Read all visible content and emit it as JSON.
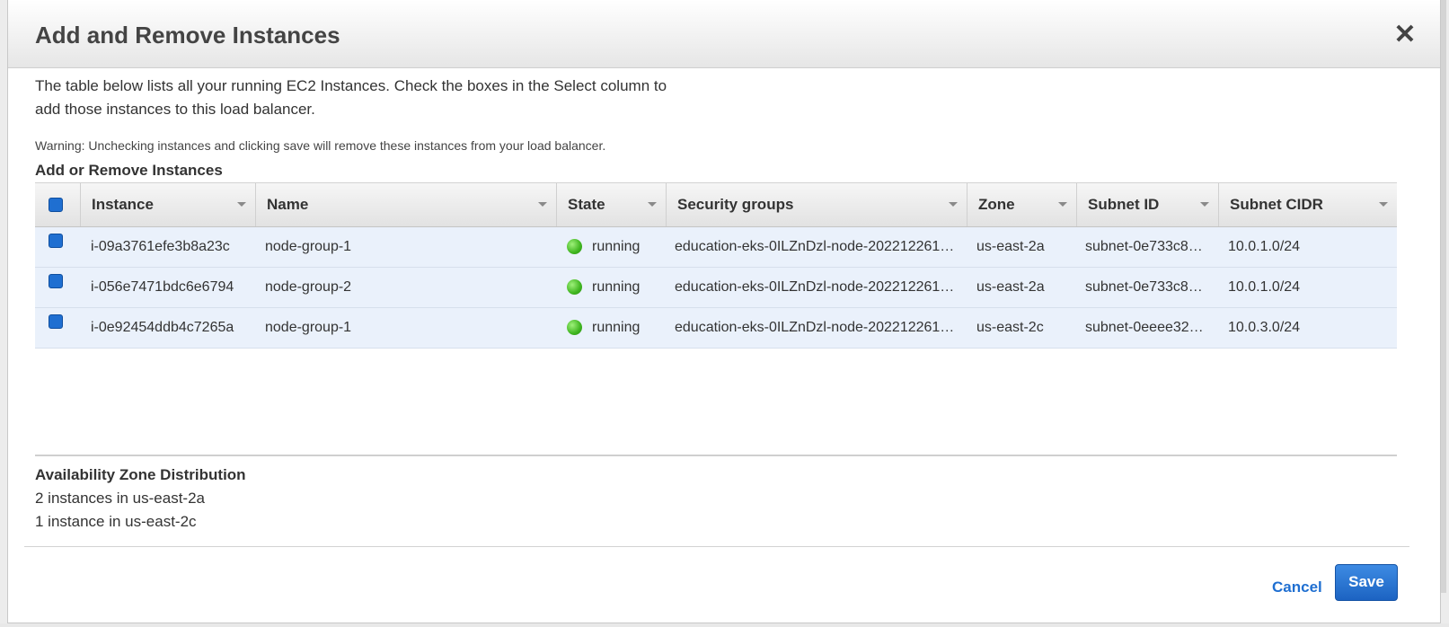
{
  "dialog": {
    "title": "Add and Remove Instances",
    "close_icon": "close-icon",
    "intro_line1": "The table below lists all your running EC2 Instances. Check the boxes in the Select column to",
    "intro_line2": "add those instances to this load balancer.",
    "warning": "Warning: Unchecking instances and clicking save will remove these instances from your load balancer.",
    "section_title": "Add or Remove Instances"
  },
  "table": {
    "select_all_checked": true,
    "columns": [
      "Instance",
      "Name",
      "State",
      "Security groups",
      "Zone",
      "Subnet ID",
      "Subnet CIDR"
    ],
    "rows": [
      {
        "checked": true,
        "instance": "i-09a3761efe3b8a23c",
        "name": "node-group-1",
        "state": "running",
        "state_color": "#3fb51f",
        "security_groups": "education-eks-0ILZnDzl-node-202212261…",
        "zone": "us-east-2a",
        "subnet_id": "subnet-0e733c8…",
        "subnet_cidr": "10.0.1.0/24"
      },
      {
        "checked": true,
        "instance": "i-056e7471bdc6e6794",
        "name": "node-group-2",
        "state": "running",
        "state_color": "#3fb51f",
        "security_groups": "education-eks-0ILZnDzl-node-202212261…",
        "zone": "us-east-2a",
        "subnet_id": "subnet-0e733c8…",
        "subnet_cidr": "10.0.1.0/24"
      },
      {
        "checked": true,
        "instance": "i-0e92454ddb4c7265a",
        "name": "node-group-1",
        "state": "running",
        "state_color": "#3fb51f",
        "security_groups": "education-eks-0ILZnDzl-node-202212261…",
        "zone": "us-east-2c",
        "subnet_id": "subnet-0eeee32…",
        "subnet_cidr": "10.0.3.0/24"
      }
    ]
  },
  "az_distribution": {
    "title": "Availability Zone Distribution",
    "lines": [
      "2 instances in us-east-2a",
      "1 instance in us-east-2c"
    ]
  },
  "footer": {
    "cancel_label": "Cancel",
    "save_label": "Save"
  },
  "colors": {
    "accent": "#1f6fd1",
    "row_bg": "#eaf1fb",
    "running": "#3fb51f"
  }
}
